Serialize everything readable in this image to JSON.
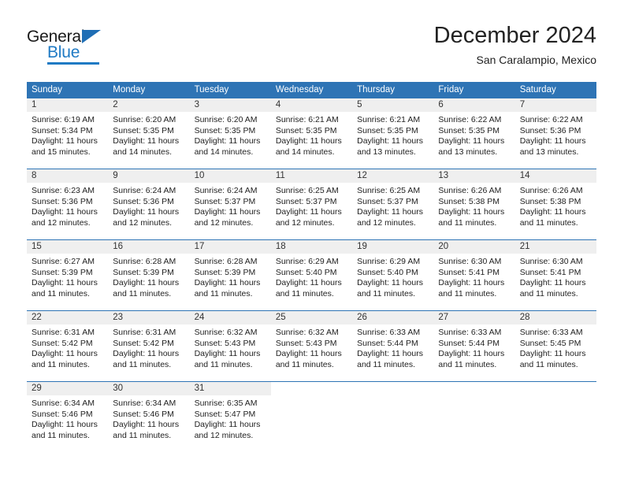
{
  "brand": {
    "name_part1": "General",
    "name_part2": "Blue",
    "triangle_color": "#1f6eb5",
    "blue_color": "#1f7ac4"
  },
  "header": {
    "title": "December 2024",
    "subtitle": "San Caralampio, Mexico"
  },
  "theme": {
    "header_blue": "#2e74b5",
    "daynum_band": "#efefef",
    "text": "#222222"
  },
  "weekdays": [
    "Sunday",
    "Monday",
    "Tuesday",
    "Wednesday",
    "Thursday",
    "Friday",
    "Saturday"
  ],
  "weeks": [
    [
      {
        "day": "1",
        "sunrise": "Sunrise: 6:19 AM",
        "sunset": "Sunset: 5:34 PM",
        "daylight_line1": "Daylight: 11 hours",
        "daylight_line2": "and 15 minutes."
      },
      {
        "day": "2",
        "sunrise": "Sunrise: 6:20 AM",
        "sunset": "Sunset: 5:35 PM",
        "daylight_line1": "Daylight: 11 hours",
        "daylight_line2": "and 14 minutes."
      },
      {
        "day": "3",
        "sunrise": "Sunrise: 6:20 AM",
        "sunset": "Sunset: 5:35 PM",
        "daylight_line1": "Daylight: 11 hours",
        "daylight_line2": "and 14 minutes."
      },
      {
        "day": "4",
        "sunrise": "Sunrise: 6:21 AM",
        "sunset": "Sunset: 5:35 PM",
        "daylight_line1": "Daylight: 11 hours",
        "daylight_line2": "and 14 minutes."
      },
      {
        "day": "5",
        "sunrise": "Sunrise: 6:21 AM",
        "sunset": "Sunset: 5:35 PM",
        "daylight_line1": "Daylight: 11 hours",
        "daylight_line2": "and 13 minutes."
      },
      {
        "day": "6",
        "sunrise": "Sunrise: 6:22 AM",
        "sunset": "Sunset: 5:35 PM",
        "daylight_line1": "Daylight: 11 hours",
        "daylight_line2": "and 13 minutes."
      },
      {
        "day": "7",
        "sunrise": "Sunrise: 6:22 AM",
        "sunset": "Sunset: 5:36 PM",
        "daylight_line1": "Daylight: 11 hours",
        "daylight_line2": "and 13 minutes."
      }
    ],
    [
      {
        "day": "8",
        "sunrise": "Sunrise: 6:23 AM",
        "sunset": "Sunset: 5:36 PM",
        "daylight_line1": "Daylight: 11 hours",
        "daylight_line2": "and 12 minutes."
      },
      {
        "day": "9",
        "sunrise": "Sunrise: 6:24 AM",
        "sunset": "Sunset: 5:36 PM",
        "daylight_line1": "Daylight: 11 hours",
        "daylight_line2": "and 12 minutes."
      },
      {
        "day": "10",
        "sunrise": "Sunrise: 6:24 AM",
        "sunset": "Sunset: 5:37 PM",
        "daylight_line1": "Daylight: 11 hours",
        "daylight_line2": "and 12 minutes."
      },
      {
        "day": "11",
        "sunrise": "Sunrise: 6:25 AM",
        "sunset": "Sunset: 5:37 PM",
        "daylight_line1": "Daylight: 11 hours",
        "daylight_line2": "and 12 minutes."
      },
      {
        "day": "12",
        "sunrise": "Sunrise: 6:25 AM",
        "sunset": "Sunset: 5:37 PM",
        "daylight_line1": "Daylight: 11 hours",
        "daylight_line2": "and 12 minutes."
      },
      {
        "day": "13",
        "sunrise": "Sunrise: 6:26 AM",
        "sunset": "Sunset: 5:38 PM",
        "daylight_line1": "Daylight: 11 hours",
        "daylight_line2": "and 11 minutes."
      },
      {
        "day": "14",
        "sunrise": "Sunrise: 6:26 AM",
        "sunset": "Sunset: 5:38 PM",
        "daylight_line1": "Daylight: 11 hours",
        "daylight_line2": "and 11 minutes."
      }
    ],
    [
      {
        "day": "15",
        "sunrise": "Sunrise: 6:27 AM",
        "sunset": "Sunset: 5:39 PM",
        "daylight_line1": "Daylight: 11 hours",
        "daylight_line2": "and 11 minutes."
      },
      {
        "day": "16",
        "sunrise": "Sunrise: 6:28 AM",
        "sunset": "Sunset: 5:39 PM",
        "daylight_line1": "Daylight: 11 hours",
        "daylight_line2": "and 11 minutes."
      },
      {
        "day": "17",
        "sunrise": "Sunrise: 6:28 AM",
        "sunset": "Sunset: 5:39 PM",
        "daylight_line1": "Daylight: 11 hours",
        "daylight_line2": "and 11 minutes."
      },
      {
        "day": "18",
        "sunrise": "Sunrise: 6:29 AM",
        "sunset": "Sunset: 5:40 PM",
        "daylight_line1": "Daylight: 11 hours",
        "daylight_line2": "and 11 minutes."
      },
      {
        "day": "19",
        "sunrise": "Sunrise: 6:29 AM",
        "sunset": "Sunset: 5:40 PM",
        "daylight_line1": "Daylight: 11 hours",
        "daylight_line2": "and 11 minutes."
      },
      {
        "day": "20",
        "sunrise": "Sunrise: 6:30 AM",
        "sunset": "Sunset: 5:41 PM",
        "daylight_line1": "Daylight: 11 hours",
        "daylight_line2": "and 11 minutes."
      },
      {
        "day": "21",
        "sunrise": "Sunrise: 6:30 AM",
        "sunset": "Sunset: 5:41 PM",
        "daylight_line1": "Daylight: 11 hours",
        "daylight_line2": "and 11 minutes."
      }
    ],
    [
      {
        "day": "22",
        "sunrise": "Sunrise: 6:31 AM",
        "sunset": "Sunset: 5:42 PM",
        "daylight_line1": "Daylight: 11 hours",
        "daylight_line2": "and 11 minutes."
      },
      {
        "day": "23",
        "sunrise": "Sunrise: 6:31 AM",
        "sunset": "Sunset: 5:42 PM",
        "daylight_line1": "Daylight: 11 hours",
        "daylight_line2": "and 11 minutes."
      },
      {
        "day": "24",
        "sunrise": "Sunrise: 6:32 AM",
        "sunset": "Sunset: 5:43 PM",
        "daylight_line1": "Daylight: 11 hours",
        "daylight_line2": "and 11 minutes."
      },
      {
        "day": "25",
        "sunrise": "Sunrise: 6:32 AM",
        "sunset": "Sunset: 5:43 PM",
        "daylight_line1": "Daylight: 11 hours",
        "daylight_line2": "and 11 minutes."
      },
      {
        "day": "26",
        "sunrise": "Sunrise: 6:33 AM",
        "sunset": "Sunset: 5:44 PM",
        "daylight_line1": "Daylight: 11 hours",
        "daylight_line2": "and 11 minutes."
      },
      {
        "day": "27",
        "sunrise": "Sunrise: 6:33 AM",
        "sunset": "Sunset: 5:44 PM",
        "daylight_line1": "Daylight: 11 hours",
        "daylight_line2": "and 11 minutes."
      },
      {
        "day": "28",
        "sunrise": "Sunrise: 6:33 AM",
        "sunset": "Sunset: 5:45 PM",
        "daylight_line1": "Daylight: 11 hours",
        "daylight_line2": "and 11 minutes."
      }
    ],
    [
      {
        "day": "29",
        "sunrise": "Sunrise: 6:34 AM",
        "sunset": "Sunset: 5:46 PM",
        "daylight_line1": "Daylight: 11 hours",
        "daylight_line2": "and 11 minutes."
      },
      {
        "day": "30",
        "sunrise": "Sunrise: 6:34 AM",
        "sunset": "Sunset: 5:46 PM",
        "daylight_line1": "Daylight: 11 hours",
        "daylight_line2": "and 11 minutes."
      },
      {
        "day": "31",
        "sunrise": "Sunrise: 6:35 AM",
        "sunset": "Sunset: 5:47 PM",
        "daylight_line1": "Daylight: 11 hours",
        "daylight_line2": "and 12 minutes."
      },
      {
        "day": "",
        "sunrise": "",
        "sunset": "",
        "daylight_line1": "",
        "daylight_line2": ""
      },
      {
        "day": "",
        "sunrise": "",
        "sunset": "",
        "daylight_line1": "",
        "daylight_line2": ""
      },
      {
        "day": "",
        "sunrise": "",
        "sunset": "",
        "daylight_line1": "",
        "daylight_line2": ""
      },
      {
        "day": "",
        "sunrise": "",
        "sunset": "",
        "daylight_line1": "",
        "daylight_line2": ""
      }
    ]
  ]
}
